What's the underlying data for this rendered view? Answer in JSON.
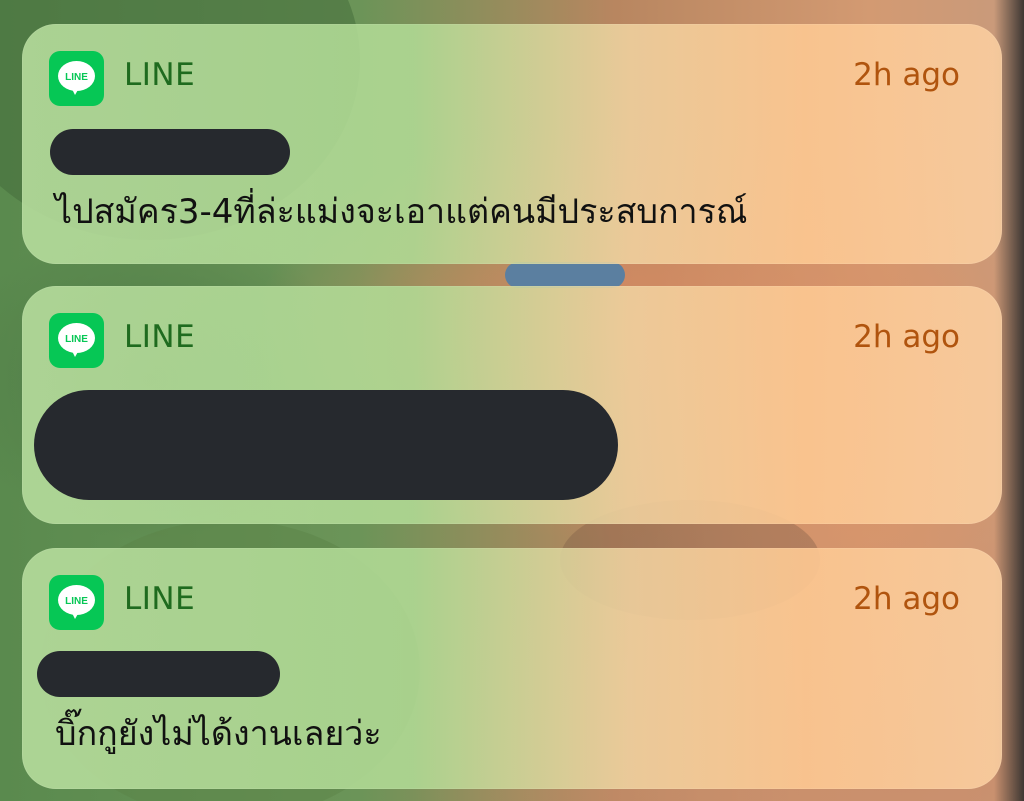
{
  "notifications": [
    {
      "app_icon": "line-logo-icon",
      "app_name": "LINE",
      "icon_text": "LINE",
      "time": "2h ago",
      "sender": "",
      "message": "ไปสมัคร3-4ที่ล่ะแม่งจะเอาแต่คนมีประสบการณ์"
    },
    {
      "app_icon": "line-logo-icon",
      "app_name": "LINE",
      "icon_text": "LINE",
      "time": "2h ago",
      "sender": "",
      "message": ""
    },
    {
      "app_icon": "line-logo-icon",
      "app_name": "LINE",
      "icon_text": "LINE",
      "time": "2h ago",
      "sender": "",
      "message": "บิ๊กกูยังไม่ได้งานเลยว่ะ"
    }
  ],
  "colors": {
    "line_green": "#06c755",
    "app_name": "#1f6b1f",
    "time": "#b0540e",
    "redaction": "#26292e"
  }
}
